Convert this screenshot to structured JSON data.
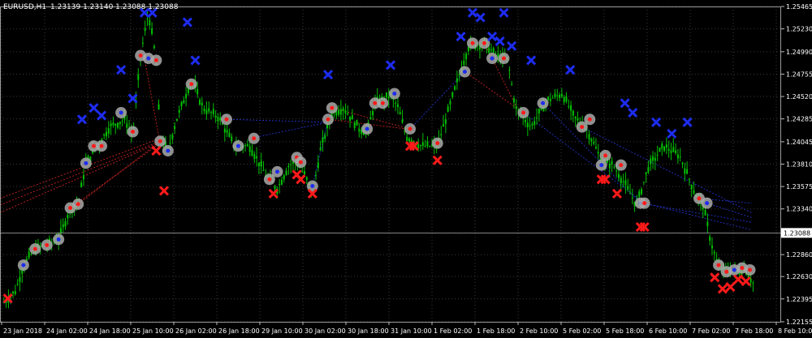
{
  "header": {
    "symbol": "EURUSD,H1",
    "ohlc": "1.23139 1.23140 1.23088 1.23088"
  },
  "current_price_label": "1.23088",
  "colors": {
    "background": "#000000",
    "grid": "#3a3a3a",
    "candle": "#00c000",
    "buy_mark": "#1e2cf0",
    "sell_mark": "#ff1a1a",
    "buy_line": "#2233cc",
    "sell_line": "#cc2222",
    "text": "#ffffff"
  },
  "chart_data": {
    "type": "candlestick",
    "y_ticks": [
      "1.25465",
      "1.25230",
      "1.24990",
      "1.24755",
      "1.24520",
      "1.24285",
      "1.24045",
      "1.23810",
      "1.23575",
      "1.23340",
      "1.23088",
      "1.22860",
      "1.22630",
      "1.22395",
      "1.22155"
    ],
    "ylim": [
      1.22155,
      1.25465
    ],
    "x_ticks": [
      "23 Jan 2018",
      "24 Jan 02:00",
      "24 Jan 18:00",
      "25 Jan 10:00",
      "26 Jan 02:00",
      "26 Jan 18:00",
      "29 Jan 10:00",
      "30 Jan 02:00",
      "30 Jan 18:00",
      "31 Jan 10:00",
      "1 Feb 02:00",
      "1 Feb 18:00",
      "2 Feb 10:00",
      "5 Feb 02:00",
      "5 Feb 18:00",
      "6 Feb 10:00",
      "7 Feb 02:00",
      "7 Feb 18:00",
      "8 Feb 10:00"
    ],
    "current_price": 1.23088,
    "price_path": [
      [
        0,
        1.2232
      ],
      [
        0.02,
        1.2248
      ],
      [
        0.03,
        1.2275
      ],
      [
        0.045,
        1.2292
      ],
      [
        0.06,
        1.2296
      ],
      [
        0.075,
        1.2302
      ],
      [
        0.09,
        1.2335
      ],
      [
        0.1,
        1.2339
      ],
      [
        0.11,
        1.2382
      ],
      [
        0.125,
        1.24
      ],
      [
        0.14,
        1.242
      ],
      [
        0.16,
        1.2428
      ],
      [
        0.17,
        1.241
      ],
      [
        0.18,
        1.2495
      ],
      [
        0.19,
        1.254
      ],
      [
        0.2,
        1.249
      ],
      [
        0.205,
        1.241
      ],
      [
        0.215,
        1.2395
      ],
      [
        0.225,
        1.2425
      ],
      [
        0.245,
        1.247
      ],
      [
        0.26,
        1.244
      ],
      [
        0.28,
        1.243
      ],
      [
        0.3,
        1.24
      ],
      [
        0.32,
        1.24
      ],
      [
        0.34,
        1.237
      ],
      [
        0.355,
        1.2355
      ],
      [
        0.37,
        1.238
      ],
      [
        0.38,
        1.2383
      ],
      [
        0.39,
        1.237
      ],
      [
        0.4,
        1.235
      ],
      [
        0.41,
        1.2395
      ],
      [
        0.425,
        1.2435
      ],
      [
        0.44,
        1.244
      ],
      [
        0.46,
        1.2418
      ],
      [
        0.47,
        1.2415
      ],
      [
        0.48,
        1.2445
      ],
      [
        0.5,
        1.2453
      ],
      [
        0.51,
        1.244
      ],
      [
        0.52,
        1.241
      ],
      [
        0.54,
        1.24
      ],
      [
        0.56,
        1.24
      ],
      [
        0.575,
        1.244
      ],
      [
        0.59,
        1.248
      ],
      [
        0.6,
        1.2505
      ],
      [
        0.62,
        1.2508
      ],
      [
        0.635,
        1.2495
      ],
      [
        0.65,
        1.249
      ],
      [
        0.66,
        1.244
      ],
      [
        0.68,
        1.242
      ],
      [
        0.7,
        1.2448
      ],
      [
        0.72,
        1.2455
      ],
      [
        0.735,
        1.243
      ],
      [
        0.75,
        1.242
      ],
      [
        0.77,
        1.2385
      ],
      [
        0.785,
        1.238
      ],
      [
        0.8,
        1.236
      ],
      [
        0.815,
        1.2338
      ],
      [
        0.83,
        1.2378
      ],
      [
        0.85,
        1.24
      ],
      [
        0.87,
        1.239
      ],
      [
        0.89,
        1.235
      ],
      [
        0.9,
        1.2338
      ],
      [
        0.91,
        1.23
      ],
      [
        0.92,
        1.2272
      ],
      [
        0.94,
        1.2268
      ],
      [
        0.955,
        1.227
      ],
      [
        0.965,
        1.2255
      ]
    ],
    "buy_points": [
      [
        0.01,
        1.224
      ],
      [
        0.105,
        1.2428
      ],
      [
        0.12,
        1.244
      ],
      [
        0.13,
        1.2432
      ],
      [
        0.155,
        1.248
      ],
      [
        0.17,
        1.245
      ],
      [
        0.185,
        1.254
      ],
      [
        0.195,
        1.254
      ],
      [
        0.24,
        1.253
      ],
      [
        0.25,
        1.249
      ],
      [
        0.42,
        1.2475
      ],
      [
        0.5,
        1.2485
      ],
      [
        0.59,
        1.2515
      ],
      [
        0.605,
        1.254
      ],
      [
        0.615,
        1.2535
      ],
      [
        0.63,
        1.2515
      ],
      [
        0.64,
        1.251
      ],
      [
        0.645,
        1.254
      ],
      [
        0.655,
        1.2505
      ],
      [
        0.68,
        1.249
      ],
      [
        0.73,
        1.248
      ],
      [
        0.8,
        1.2445
      ],
      [
        0.81,
        1.2435
      ],
      [
        0.84,
        1.2425
      ],
      [
        0.86,
        1.2413
      ],
      [
        0.88,
        1.2425
      ]
    ],
    "sell_points": [
      [
        0.01,
        1.224
      ],
      [
        0.2,
        1.2395
      ],
      [
        0.21,
        1.2353
      ],
      [
        0.35,
        1.235
      ],
      [
        0.38,
        1.237
      ],
      [
        0.385,
        1.2365
      ],
      [
        0.4,
        1.235
      ],
      [
        0.525,
        1.24
      ],
      [
        0.53,
        1.24
      ],
      [
        0.56,
        1.2385
      ],
      [
        0.77,
        1.2365
      ],
      [
        0.775,
        1.2365
      ],
      [
        0.79,
        1.235
      ],
      [
        0.82,
        1.2315
      ],
      [
        0.825,
        1.2315
      ],
      [
        0.915,
        1.2262
      ],
      [
        0.925,
        1.225
      ],
      [
        0.935,
        1.2252
      ],
      [
        0.945,
        1.226
      ],
      [
        0.955,
        1.2258
      ]
    ],
    "open_points": [
      [
        0.03,
        1.2275
      ],
      [
        0.045,
        1.2292
      ],
      [
        0.06,
        1.2296
      ],
      [
        0.075,
        1.2302
      ],
      [
        0.09,
        1.2335
      ],
      [
        0.1,
        1.2339
      ],
      [
        0.11,
        1.2382
      ],
      [
        0.12,
        1.24
      ],
      [
        0.13,
        1.24
      ],
      [
        0.155,
        1.2435
      ],
      [
        0.17,
        1.2415
      ],
      [
        0.18,
        1.2495
      ],
      [
        0.19,
        1.2492
      ],
      [
        0.2,
        1.249
      ],
      [
        0.205,
        1.2405
      ],
      [
        0.215,
        1.2395
      ],
      [
        0.245,
        1.2465
      ],
      [
        0.29,
        1.2428
      ],
      [
        0.305,
        1.24
      ],
      [
        0.325,
        1.2408
      ],
      [
        0.345,
        1.2365
      ],
      [
        0.355,
        1.2373
      ],
      [
        0.38,
        1.2388
      ],
      [
        0.385,
        1.2383
      ],
      [
        0.4,
        1.2358
      ],
      [
        0.42,
        1.2428
      ],
      [
        0.425,
        1.244
      ],
      [
        0.47,
        1.2418
      ],
      [
        0.48,
        1.2445
      ],
      [
        0.49,
        1.2445
      ],
      [
        0.505,
        1.2455
      ],
      [
        0.525,
        1.2418
      ],
      [
        0.56,
        1.2403
      ],
      [
        0.595,
        1.2478
      ],
      [
        0.605,
        1.2508
      ],
      [
        0.62,
        1.2508
      ],
      [
        0.63,
        1.2492
      ],
      [
        0.645,
        1.2492
      ],
      [
        0.67,
        1.2435
      ],
      [
        0.695,
        1.2445
      ],
      [
        0.745,
        1.242
      ],
      [
        0.755,
        1.2428
      ],
      [
        0.77,
        1.238
      ],
      [
        0.775,
        1.239
      ],
      [
        0.795,
        1.238
      ],
      [
        0.82,
        1.234
      ],
      [
        0.825,
        1.234
      ],
      [
        0.895,
        1.2345
      ],
      [
        0.905,
        1.234
      ],
      [
        0.92,
        1.2275
      ],
      [
        0.93,
        1.2268
      ],
      [
        0.94,
        1.227
      ],
      [
        0.95,
        1.2272
      ],
      [
        0.96,
        1.227
      ]
    ]
  }
}
